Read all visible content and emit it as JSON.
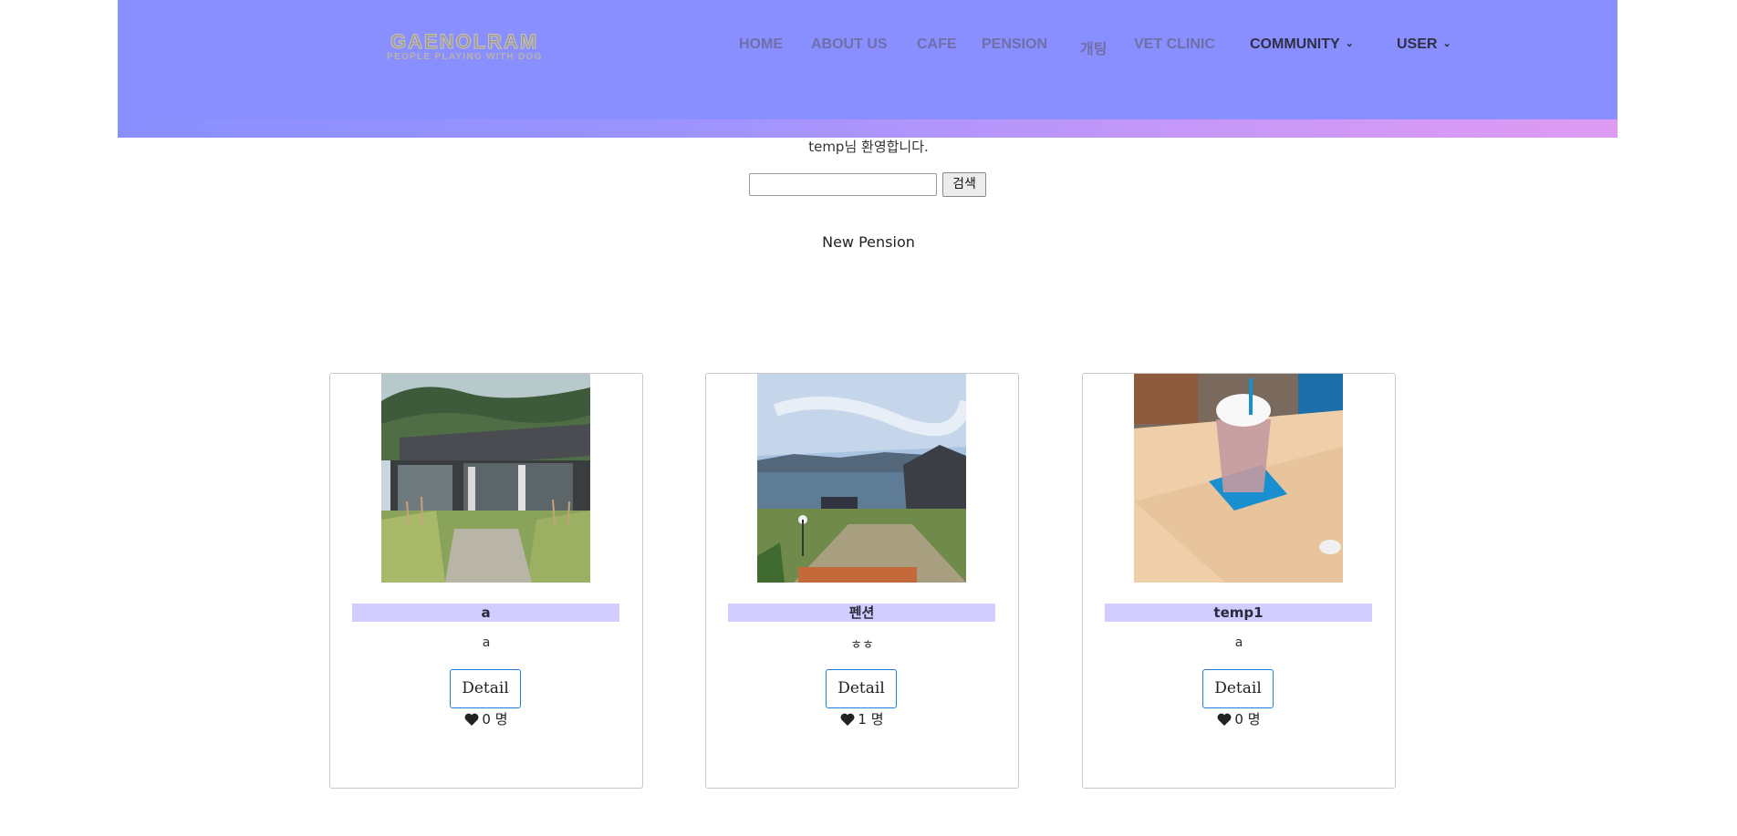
{
  "header": {
    "logo_title": "GAENOLRAM",
    "logo_subtitle": "PEOPLE PLAYING WITH DOG",
    "nav": [
      {
        "label": "HOME"
      },
      {
        "label": "ABOUT US"
      },
      {
        "label": "CAFE"
      },
      {
        "label": "PENSION"
      },
      {
        "label": "개팅"
      },
      {
        "label": "VET CLINIC"
      },
      {
        "label": "COMMUNITY"
      },
      {
        "label": "USER"
      }
    ],
    "colors": {
      "bar": "#8a8fff",
      "strip_end": "#df9bf3",
      "nav_text": "#6f6fa8",
      "nav_text_active": "#2f2f46"
    }
  },
  "welcome": "temp님 환영합니다.",
  "search": {
    "value": "",
    "button_label": "검색"
  },
  "section_title": "New Pension",
  "cards": [
    {
      "name": "a",
      "description": "a",
      "button_label": "Detail",
      "like_count": "0",
      "like_unit": "명",
      "image_icon": "building-photo"
    },
    {
      "name": "펜션",
      "description": "ㅎㅎ",
      "button_label": "Detail",
      "like_count": "1",
      "like_unit": "명",
      "image_icon": "seaside-photo"
    },
    {
      "name": "temp1",
      "description": "a",
      "button_label": "Detail",
      "like_count": "0",
      "like_unit": "명",
      "image_icon": "drink-photo"
    }
  ]
}
